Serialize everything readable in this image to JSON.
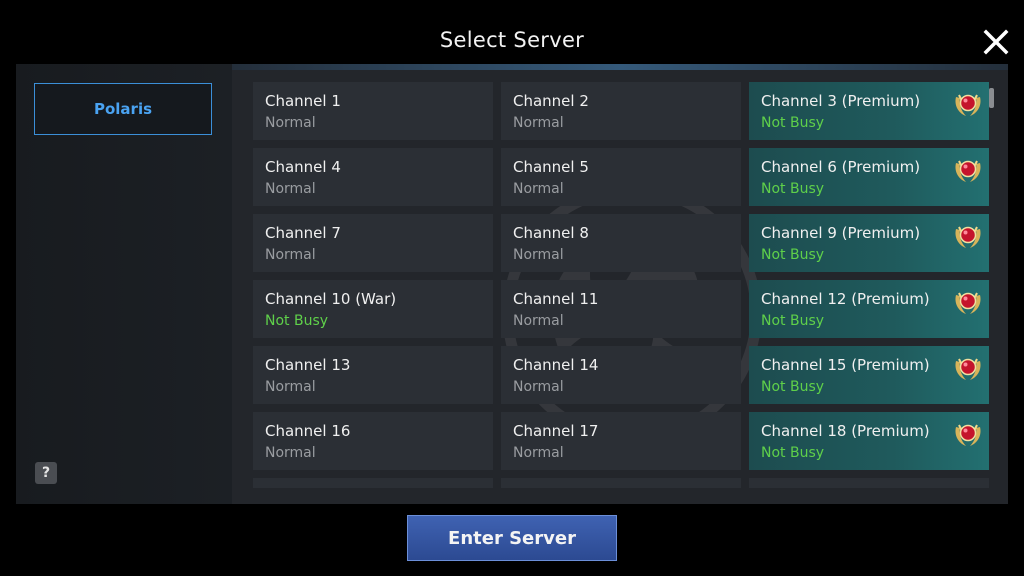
{
  "header": {
    "title": "Select Server",
    "close_icon": "close-icon"
  },
  "sidebar": {
    "servers": [
      {
        "label": "Polaris",
        "selected": true
      }
    ],
    "help_label": "?"
  },
  "channels": [
    {
      "name": "Channel 1",
      "status": "Normal",
      "premium": false
    },
    {
      "name": "Channel 2",
      "status": "Normal",
      "premium": false
    },
    {
      "name": "Channel 3 (Premium)",
      "status": "Not Busy",
      "premium": true
    },
    {
      "name": "Channel 4",
      "status": "Normal",
      "premium": false
    },
    {
      "name": "Channel 5",
      "status": "Normal",
      "premium": false
    },
    {
      "name": "Channel 6 (Premium)",
      "status": "Not Busy",
      "premium": true
    },
    {
      "name": "Channel 7",
      "status": "Normal",
      "premium": false
    },
    {
      "name": "Channel 8",
      "status": "Normal",
      "premium": false
    },
    {
      "name": "Channel 9 (Premium)",
      "status": "Not Busy",
      "premium": true
    },
    {
      "name": "Channel 10 (War)",
      "status": "Not Busy",
      "premium": false
    },
    {
      "name": "Channel 11",
      "status": "Normal",
      "premium": false
    },
    {
      "name": "Channel 12 (Premium)",
      "status": "Not Busy",
      "premium": true
    },
    {
      "name": "Channel 13",
      "status": "Normal",
      "premium": false
    },
    {
      "name": "Channel 14",
      "status": "Normal",
      "premium": false
    },
    {
      "name": "Channel 15 (Premium)",
      "status": "Not Busy",
      "premium": true
    },
    {
      "name": "Channel 16",
      "status": "Normal",
      "premium": false
    },
    {
      "name": "Channel 17",
      "status": "Normal",
      "premium": false
    },
    {
      "name": "Channel 18 (Premium)",
      "status": "Not Busy",
      "premium": true
    }
  ],
  "status_colors": {
    "Normal": "#9a9da1",
    "Not Busy": "#5fd04a"
  },
  "colors": {
    "accent": "#4aa3f2",
    "premium_bg": "#1f5a5c",
    "button_bg": "#2c4a92"
  },
  "footer": {
    "enter_label": "Enter Server"
  }
}
